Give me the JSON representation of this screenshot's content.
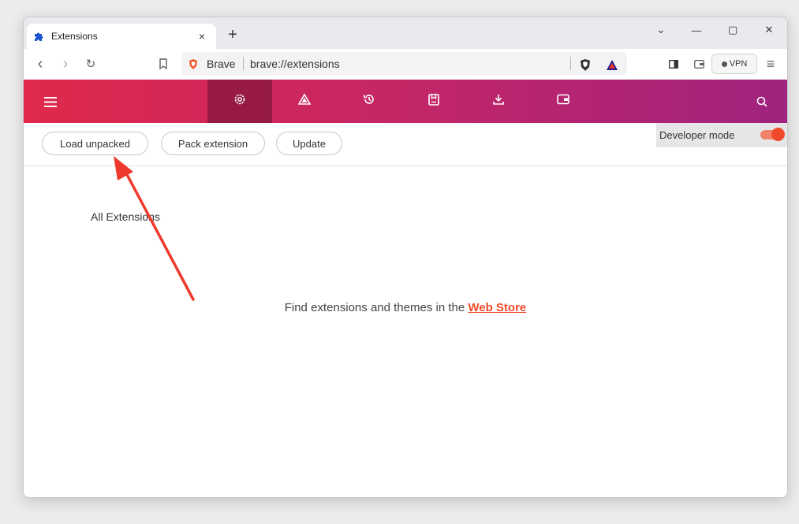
{
  "tab": {
    "title": "Extensions",
    "close": "×",
    "new_tab": "+"
  },
  "window_controls": {
    "dropdown": "⌄",
    "minimize": "—",
    "maximize": "▢",
    "close": "✕"
  },
  "toolbar": {
    "back": "‹",
    "forward": "›",
    "reload": "↻",
    "url_brand": "Brave",
    "url": "brave://extensions",
    "vpn_label": "VPN",
    "menu": "≡"
  },
  "header": {
    "menu": "≡"
  },
  "dev_bar": {
    "load_unpacked": "Load unpacked",
    "pack_extension": "Pack extension",
    "update": "Update",
    "developer_mode": "Developer mode",
    "developer_mode_on": true
  },
  "content": {
    "heading": "All Extensions",
    "webstore_prefix": "Find extensions and themes in the ",
    "webstore_link": "Web Store"
  },
  "colors": {
    "brand_gradient_start": "#e0294b",
    "brand_gradient_end": "#a0237f",
    "accent": "#ef4a29",
    "annotation_arrow": "#ee3a2c"
  }
}
